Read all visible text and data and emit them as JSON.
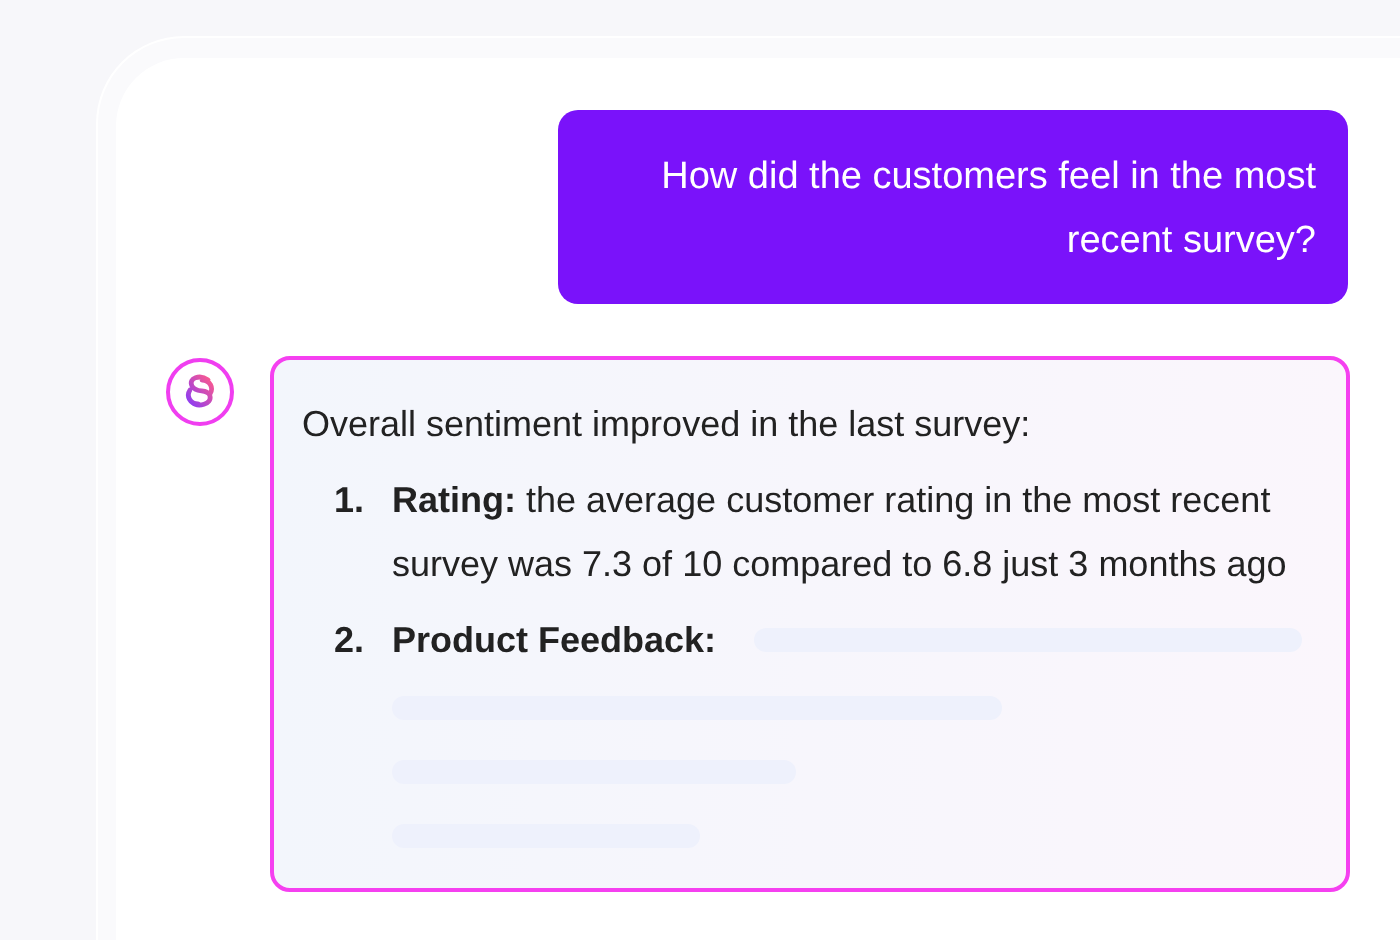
{
  "user_message": {
    "text": "How did the customers feel in the most recent survey?"
  },
  "assistant_message": {
    "intro": "Overall sentiment improved in the last survey:",
    "items": [
      {
        "number": "1.",
        "kind": "text",
        "label": "Rating:",
        "text": "the average customer rating in the most recent survey was 7.3 of 10 compared to 6.8 just 3 months ago"
      },
      {
        "number": "2.",
        "kind": "loading",
        "label": "Product Feedback:"
      }
    ]
  }
}
